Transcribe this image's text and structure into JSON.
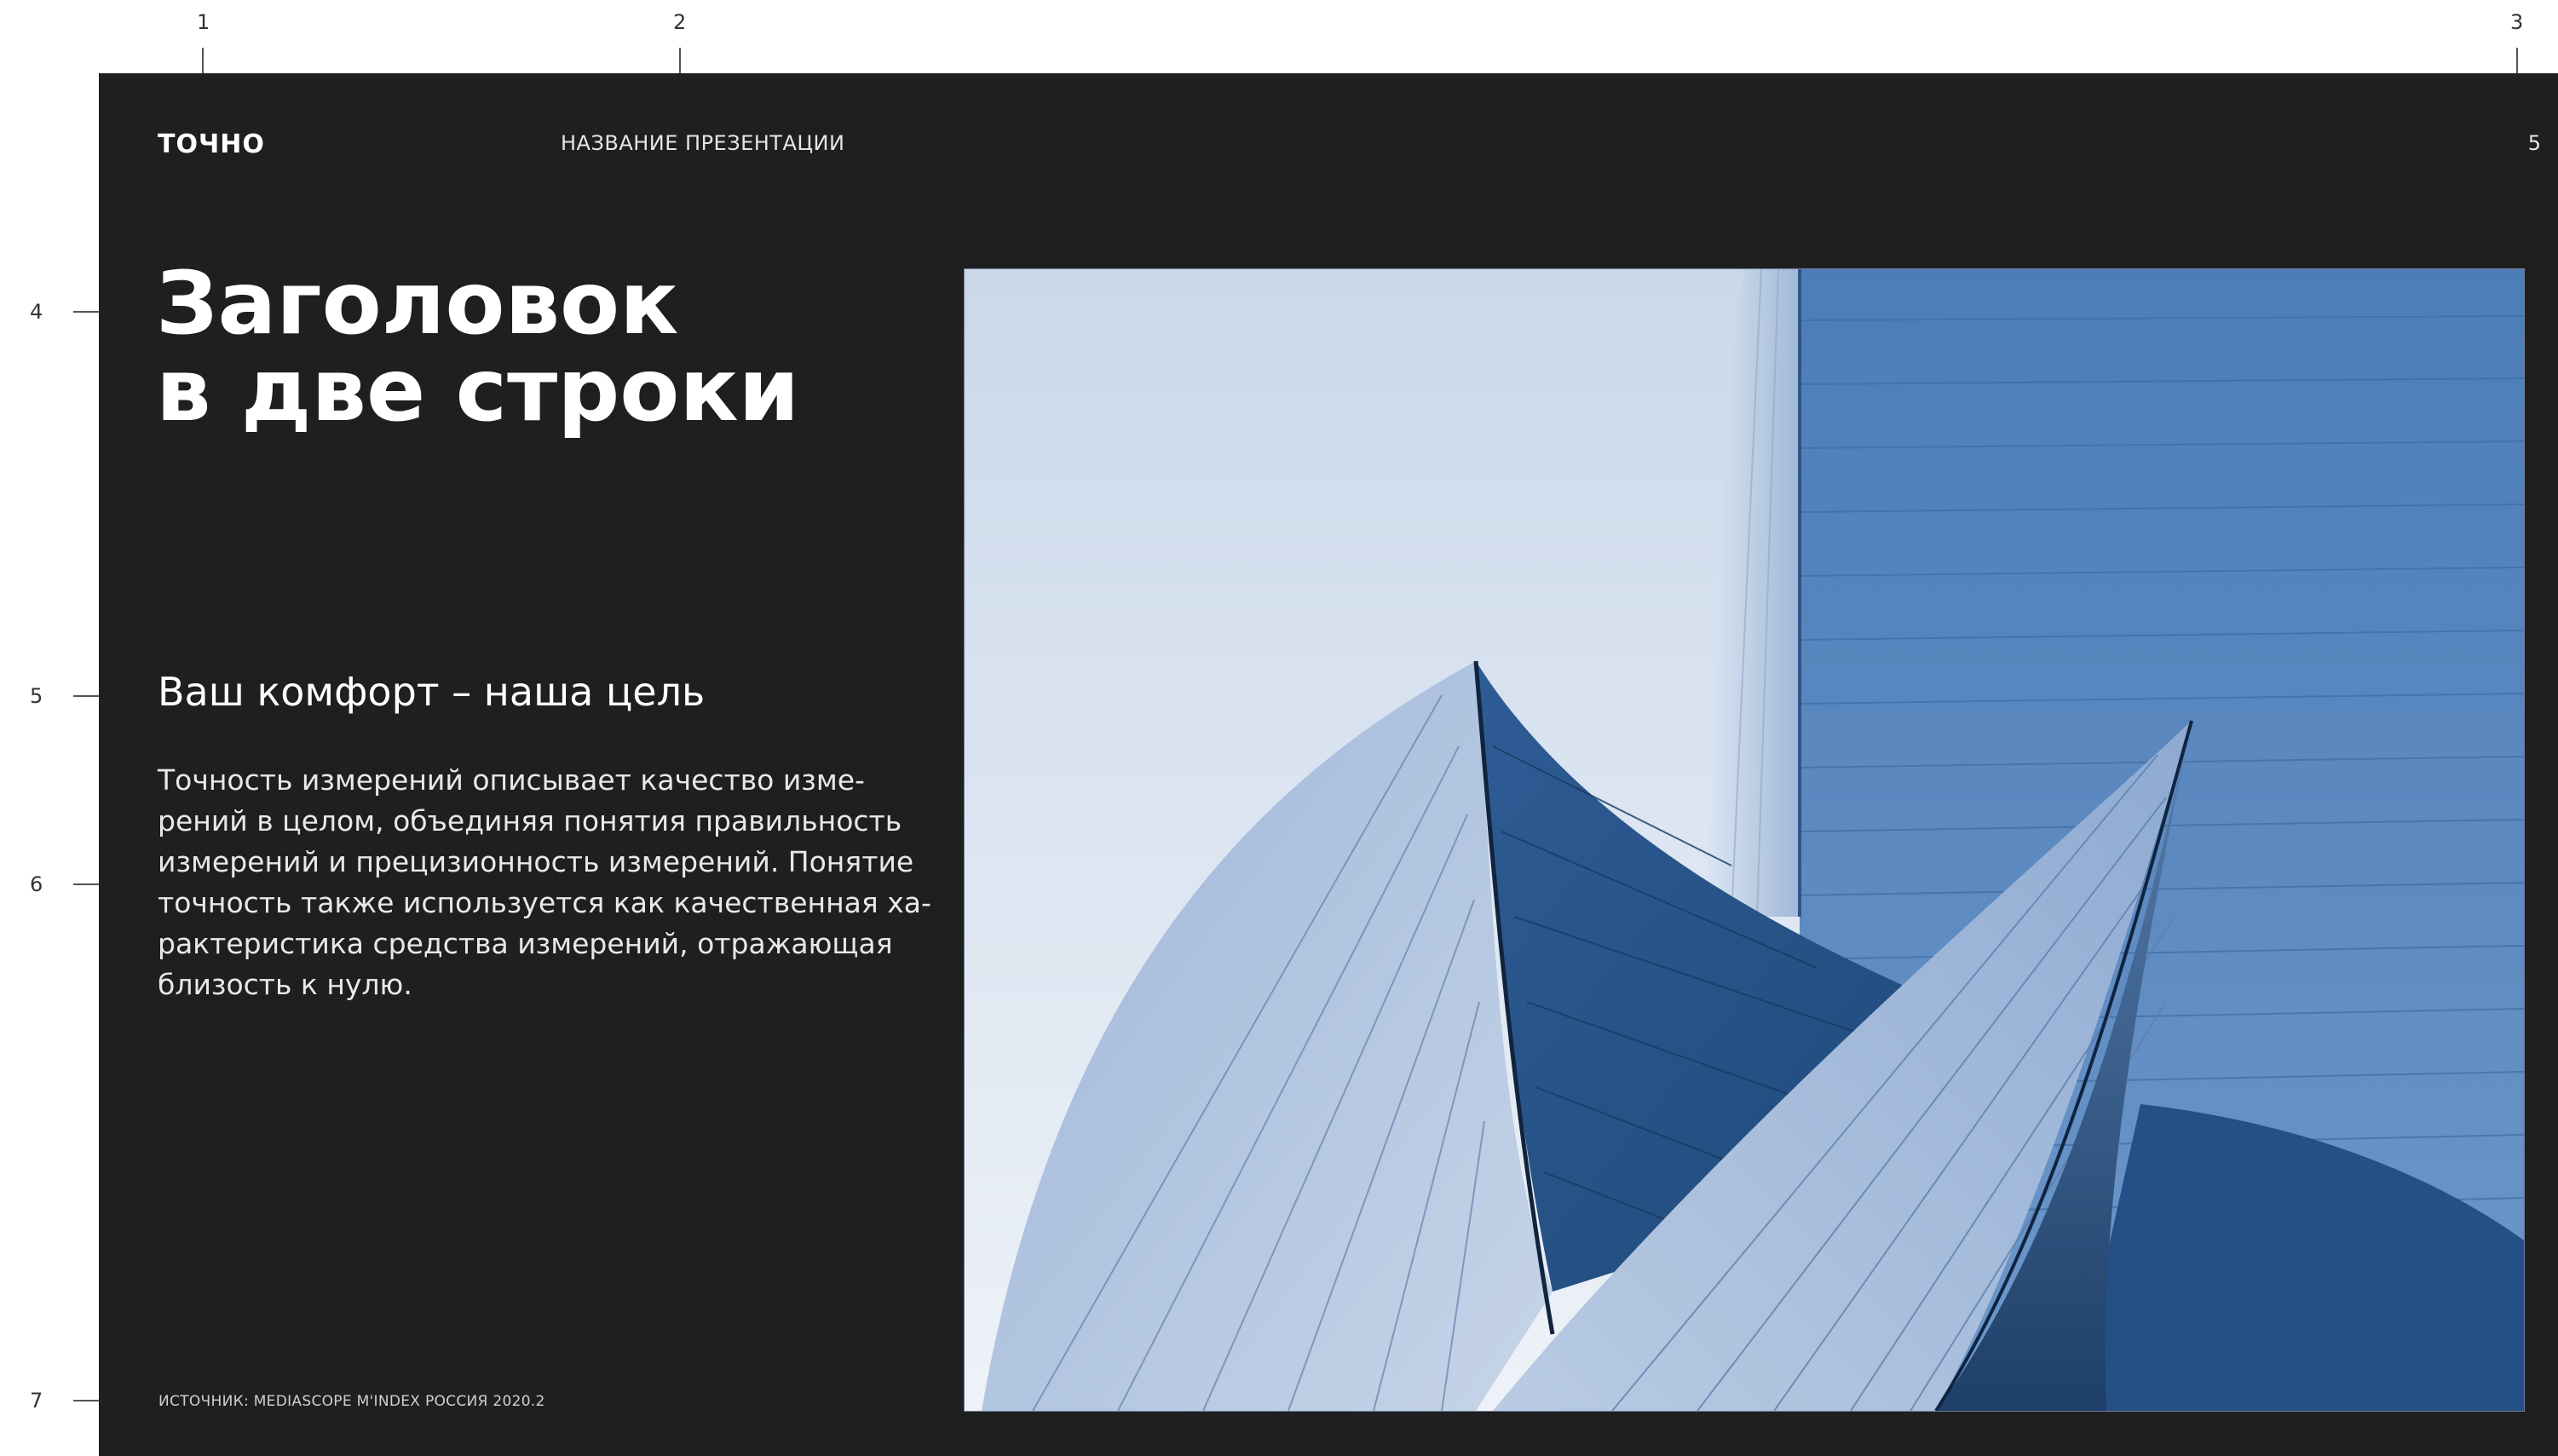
{
  "guides": {
    "columns": [
      "1",
      "2",
      "3"
    ],
    "rows": [
      "4",
      "5",
      "6",
      "7"
    ]
  },
  "slide": {
    "logo": "ТОЧНО",
    "presentation_title": "НАЗВАНИЕ ПРЕЗЕНТАЦИИ",
    "page_number": "5",
    "headline": [
      "Заголовок",
      "в две строки"
    ],
    "subtitle": "Ваш комфорт – наша цель",
    "body_lines": [
      "Точность измерений описывает качество изме-",
      "рений в целом, объединяя понятия правильность",
      "измерений и прецизионность измерений. Понятие",
      "точность также используется как качественная ха-",
      "рактеристика средства измерений, отражающая",
      "близость к нулю."
    ],
    "source": "ИСТОЧНИК: MEDIASCOPE M'INDEX РОССИЯ 2020.2",
    "image": "photo of blue curved metal architecture"
  },
  "colors": {
    "slide_background": "#1f1f1f",
    "text": "#ffffff",
    "sky": "#d6e0ee",
    "building_blue": "#4a78b0"
  }
}
